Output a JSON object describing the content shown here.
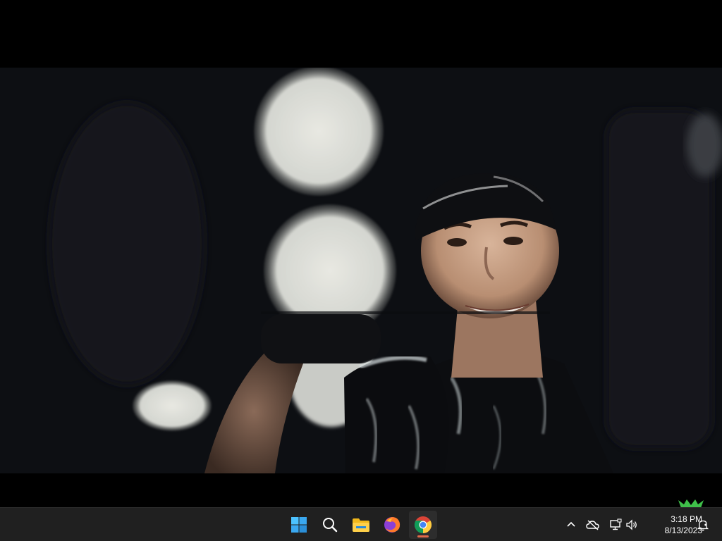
{
  "taskbar": {
    "apps": [
      {
        "name": "Start",
        "icon": "windows-start-icon"
      },
      {
        "name": "Search",
        "icon": "search-icon"
      },
      {
        "name": "File Explorer",
        "icon": "folder-icon"
      },
      {
        "name": "Firefox",
        "icon": "firefox-icon"
      },
      {
        "name": "Google Chrome",
        "icon": "chrome-icon",
        "active": true
      }
    ],
    "tray": {
      "icons": [
        "chevron-up-icon",
        "onedrive-offline-icon",
        "network-icon",
        "volume-icon",
        "notification-bell-icon"
      ],
      "time": "3:18 PM",
      "date": "8/13/2023"
    }
  },
  "colors": {
    "taskbar_bg": "#202020",
    "active_indicator": "#e06a4a",
    "video_bg": "#0f1116"
  }
}
